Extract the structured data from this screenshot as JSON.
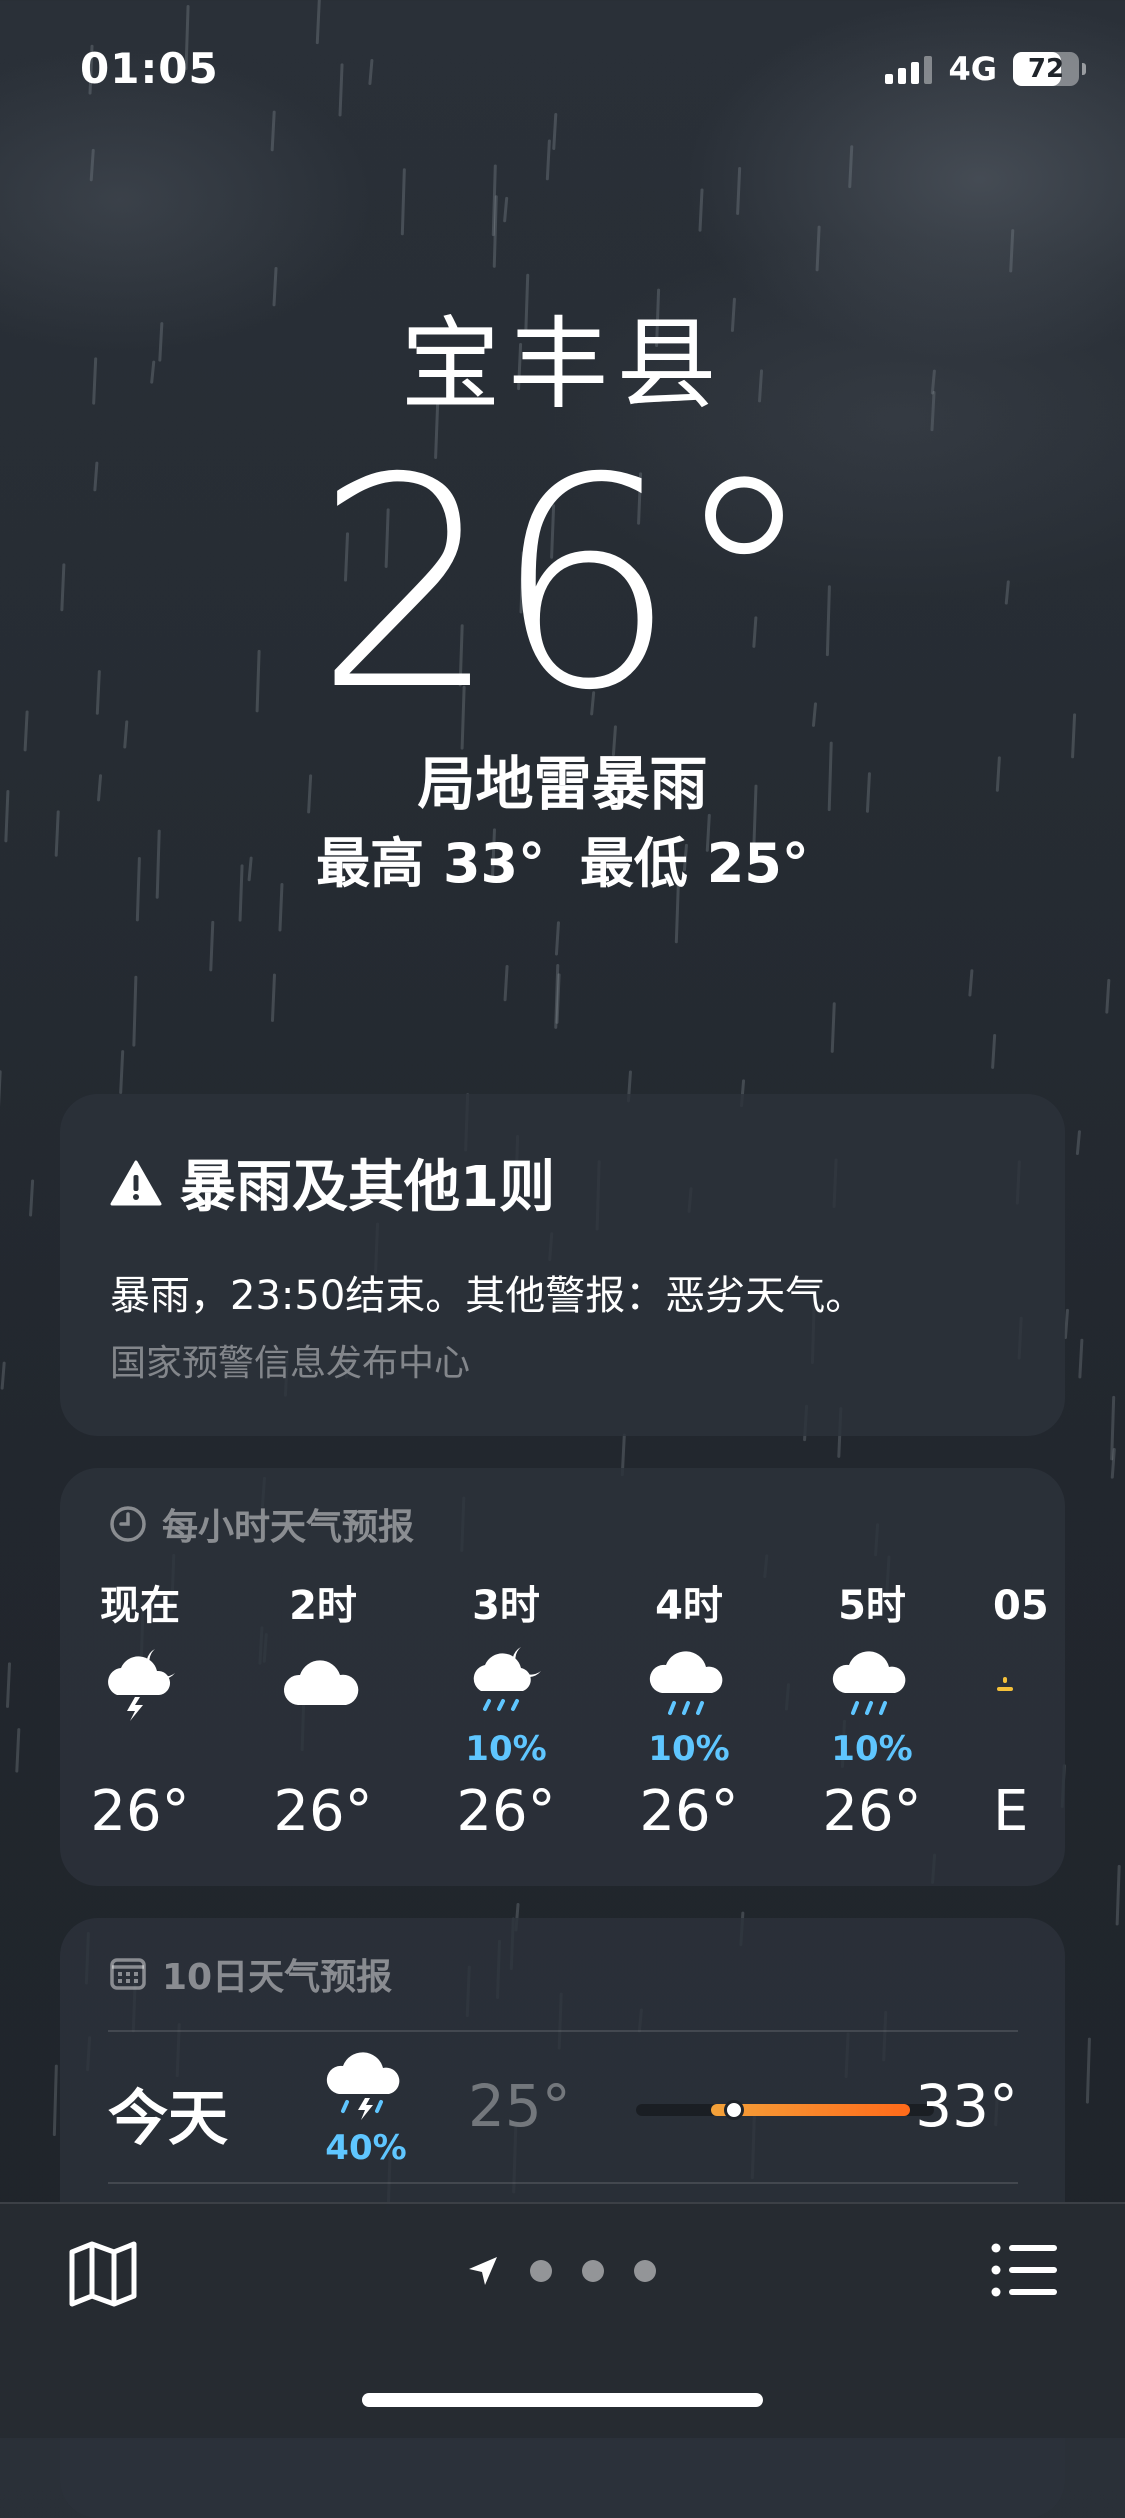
{
  "status_bar": {
    "time": "01:05",
    "network": "4G",
    "battery": "72",
    "battery_level": 0.72
  },
  "location": {
    "city": "宝丰县",
    "temperature": "26°",
    "condition": "局地雷暴雨",
    "high": "最高 33°",
    "low": "最低 25°"
  },
  "alert": {
    "icon": "warning-triangle-icon",
    "title": "暴雨及其他1则",
    "text": "暴雨，23:50结束。其他警报：恶劣天气。",
    "source": "国家预警信息发布中心"
  },
  "hourly": {
    "icon": "clock-icon",
    "title": "每小时天气预报",
    "hours": [
      {
        "label": "现在",
        "icon": "thunder-moon-cloud-icon",
        "pop": "",
        "temp": "26°"
      },
      {
        "label": "2时",
        "icon": "cloud-icon",
        "pop": "",
        "temp": "26°"
      },
      {
        "label": "3时",
        "icon": "moon-rain-cloud-icon",
        "pop": "10%",
        "temp": "26°"
      },
      {
        "label": "4时",
        "icon": "rain-cloud-icon",
        "pop": "10%",
        "temp": "26°"
      },
      {
        "label": "5时",
        "icon": "rain-cloud-icon",
        "pop": "10%",
        "temp": "26°"
      },
      {
        "label": "05",
        "icon": "sunrise-icon",
        "pop": "",
        "temp": "E"
      }
    ]
  },
  "daily": {
    "icon": "calendar-icon",
    "title": "10日天气预报",
    "days": [
      {
        "name": "今天",
        "icon": "thunder-rain-cloud-icon",
        "pop": "40%",
        "low": "25°",
        "high": "33°",
        "bar_start": 0.25,
        "bar_end": 0.92,
        "current": 0.33
      }
    ]
  },
  "bottom_bar": {
    "map_icon": "map-icon",
    "location_icon": "location-arrow-icon",
    "list_icon": "list-icon",
    "pages": 3
  },
  "colors": {
    "accent_blue": "#5fc6ff",
    "bar_orange": "#ff6a1a",
    "bar_yellow": "#f4a23a"
  }
}
